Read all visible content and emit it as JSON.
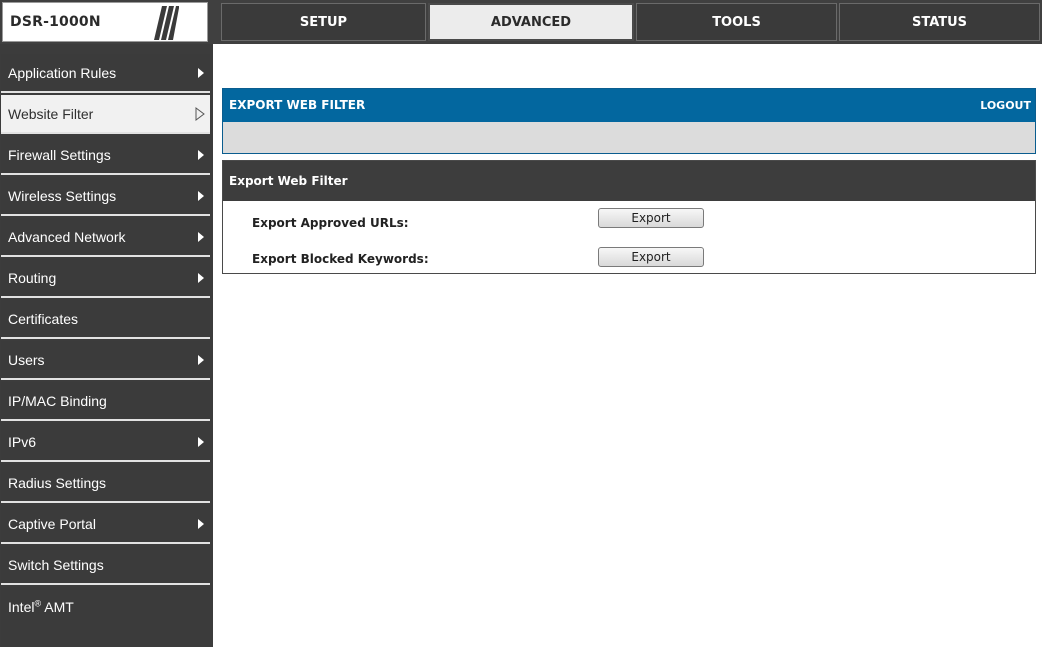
{
  "brand": {
    "model": "DSR-1000N"
  },
  "nav": {
    "tabs": [
      {
        "label": "SETUP"
      },
      {
        "label": "ADVANCED",
        "active": true
      },
      {
        "label": "TOOLS"
      },
      {
        "label": "STATUS"
      }
    ]
  },
  "sidebar": {
    "items": [
      {
        "label": "Application Rules",
        "has_submenu": true
      },
      {
        "label": "Website Filter",
        "has_submenu": true,
        "active": true
      },
      {
        "label": "Firewall Settings",
        "has_submenu": true
      },
      {
        "label": "Wireless Settings",
        "has_submenu": true
      },
      {
        "label": "Advanced Network",
        "has_submenu": true
      },
      {
        "label": "Routing",
        "has_submenu": true
      },
      {
        "label": "Certificates",
        "has_submenu": false
      },
      {
        "label": "Users",
        "has_submenu": true
      },
      {
        "label": "IP/MAC Binding",
        "has_submenu": false
      },
      {
        "label": "IPv6",
        "has_submenu": true
      },
      {
        "label": "Radius Settings",
        "has_submenu": false
      },
      {
        "label": "Captive Portal",
        "has_submenu": true
      },
      {
        "label": "Switch Settings",
        "has_submenu": false
      },
      {
        "label": "Intel",
        "sup": "®",
        "label_suffix": " AMT",
        "has_submenu": false
      }
    ]
  },
  "header": {
    "title": "EXPORT WEB FILTER",
    "logout_label": "LOGOUT"
  },
  "section": {
    "title": "Export Web Filter",
    "rows": [
      {
        "label": "Export Approved URLs:",
        "button_label": "Export"
      },
      {
        "label": "Export Blocked Keywords:",
        "button_label": "Export"
      }
    ]
  },
  "colors": {
    "header_bar": "#03679f",
    "dark_bar": "#3d3d3d",
    "sidebar_bg": "#3b3b3b",
    "active_tab_bg": "#ececec"
  }
}
